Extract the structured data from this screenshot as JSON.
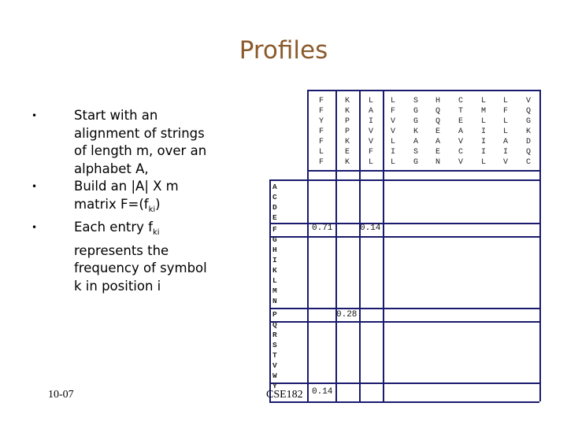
{
  "slide": {
    "title": "Profiles",
    "bullets": [
      {
        "lines": [
          "Start with an",
          "alignment of strings",
          "of length m, over an",
          "alphabet A,"
        ]
      },
      {
        "lines": [
          "Build an |A| X m"
        ],
        "line2_prefix": "matrix F=(f",
        "line2_sub": "ki",
        "line2_suffix": ")"
      },
      {
        "line1_prefix": "Each entry f",
        "line1_sub": "ki",
        "lines_after": [
          "represents the",
          "frequency of symbol",
          "k in position i"
        ]
      }
    ],
    "footer_date": "10-07",
    "footer_course": "CSE182"
  },
  "alignment_columns": [
    [
      "F",
      "F",
      "Y",
      "F",
      "F",
      "L",
      "F"
    ],
    [
      "K",
      "K",
      "P",
      "P",
      "K",
      "E",
      "K"
    ],
    [
      "L",
      "A",
      "I",
      "V",
      "V",
      "F",
      "L"
    ],
    [
      "L",
      "F",
      "V",
      "V",
      "L",
      "I",
      "L"
    ],
    [
      "S",
      "G",
      "G",
      "K",
      "A",
      "S",
      "G"
    ],
    [
      "H",
      "Q",
      "Q",
      "E",
      "A",
      "E",
      "N"
    ],
    [
      "C",
      "T",
      "E",
      "A",
      "V",
      "C",
      "V"
    ],
    [
      "L",
      "M",
      "L",
      "I",
      "I",
      "I",
      "L"
    ],
    [
      "L",
      "F",
      "L",
      "L",
      "A",
      "I",
      "V"
    ],
    [
      "V",
      "Q",
      "G",
      "K",
      "D",
      "Q",
      "C"
    ]
  ],
  "alphabet": [
    "A",
    "C",
    "D",
    "E",
    "F",
    "G",
    "H",
    "I",
    "K",
    "L",
    "M",
    "N",
    "P",
    "Q",
    "R",
    "S",
    "T",
    "V",
    "W",
    "Y"
  ],
  "profile_values": [
    {
      "symbol": "F",
      "column": 1,
      "value": "0.71"
    },
    {
      "symbol": "F",
      "column": 3,
      "value": "0.14"
    },
    {
      "symbol": "P",
      "column": 2,
      "value": "0.28"
    },
    {
      "symbol": "Y",
      "column": 1,
      "value": "0.14"
    }
  ]
}
